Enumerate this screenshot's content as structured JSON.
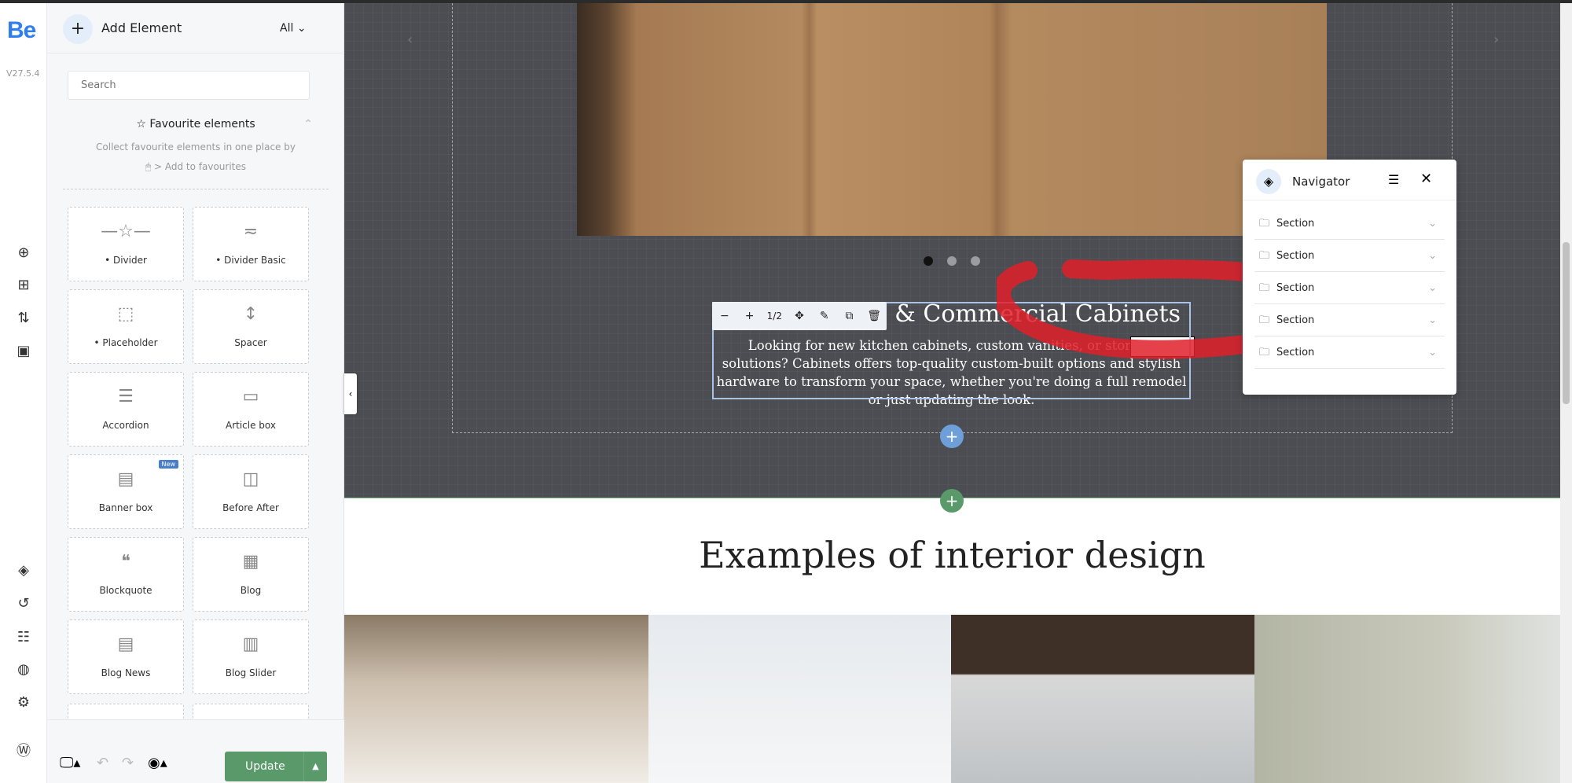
{
  "rail": {
    "logo": "Be",
    "version": "V27.5.4"
  },
  "panel": {
    "title": "Add Element",
    "filter": "All",
    "search_placeholder": "Search",
    "favourites": {
      "title": "Favourite elements",
      "desc1": "Collect favourite elements in one place by",
      "desc2": "> Add to favourites"
    },
    "elements": [
      {
        "label": "• Divider",
        "icon": "—☆—"
      },
      {
        "label": "• Divider Basic",
        "icon": "≂"
      },
      {
        "label": "• Placeholder",
        "icon": "⬚"
      },
      {
        "label": "Spacer",
        "icon": "↕"
      },
      {
        "label": "Accordion",
        "icon": "☰"
      },
      {
        "label": "Article box",
        "icon": "▭"
      },
      {
        "label": "Banner box",
        "icon": "▤",
        "badge": "New"
      },
      {
        "label": "Before After",
        "icon": "◫"
      },
      {
        "label": "Blockquote",
        "icon": "❝"
      },
      {
        "label": "Blog",
        "icon": "▦"
      },
      {
        "label": "Blog News",
        "icon": "▤"
      },
      {
        "label": "Blog Slider",
        "icon": "▥"
      }
    ],
    "update": "Update"
  },
  "canvas": {
    "heading": "l & Commercial Cabinets",
    "body": "Looking for new kitchen cabinets, custom vanities, or storage solutions? Cabinets offers top-quality custom-built options and stylish hardware to transform your space, whether you're doing a full remodel or just updating the look.",
    "toolbar": {
      "minus": "−",
      "plus": "+",
      "page": "1/2"
    },
    "section_heading": "Examples of interior design"
  },
  "navigator": {
    "title": "Navigator",
    "items": [
      "Section",
      "Section",
      "Section",
      "Section",
      "Section"
    ]
  },
  "colors": {
    "accent": "#2f7ff0",
    "update": "#5a9a6a",
    "annotation": "#e0202a"
  }
}
